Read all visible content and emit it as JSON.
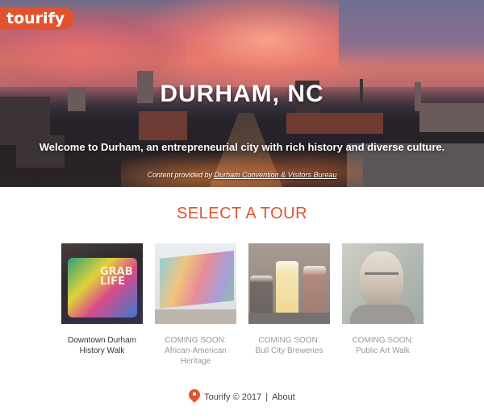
{
  "brand": {
    "logo_text": "tourify",
    "accent_color": "#e2532d"
  },
  "hero": {
    "title": "DURHAM, NC",
    "subtitle": "Welcome to Durham, an entrepreneurial city with rich history and diverse culture.",
    "credit_prefix": "Content provided by ",
    "credit_link": "Durham Convention & Visitors Bureau"
  },
  "section": {
    "title": "SELECT A TOUR"
  },
  "tours": [
    {
      "line1": "Downtown Durham",
      "line2": "History Walk",
      "status": "available"
    },
    {
      "line1": "COMING SOON:",
      "line2": "African-American Heritage",
      "status": "coming-soon"
    },
    {
      "line1": "COMING SOON:",
      "line2": "Bull City Breweries",
      "status": "coming-soon"
    },
    {
      "line1": "COMING SOON:",
      "line2": "Public Art Walk",
      "status": "coming-soon"
    }
  ],
  "footer": {
    "copyright": "Tourify © 2017",
    "separator": "|",
    "about_link": "About",
    "icon": "map-pin-icon"
  }
}
